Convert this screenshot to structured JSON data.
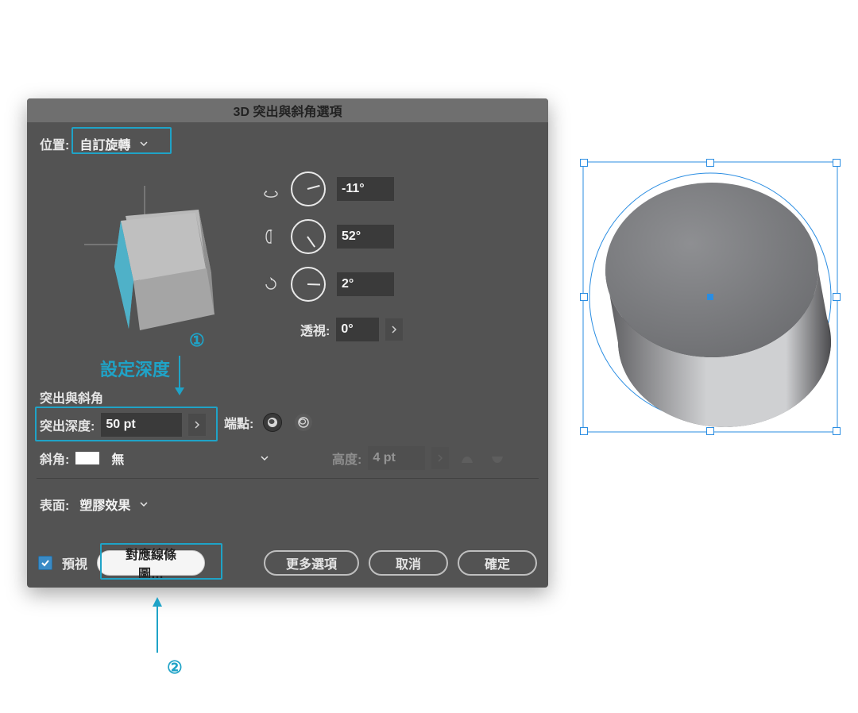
{
  "dialog": {
    "title": "3D 突出與斜角選項",
    "position_label": "位置:",
    "position_value": "自訂旋轉",
    "rotX_value": "-11°",
    "rotY_value": "52°",
    "rotZ_value": "2°",
    "perspective_label": "透視:",
    "perspective_value": "0°",
    "section_extrude_bevel": "突出與斜角",
    "extrude_depth_label": "突出深度:",
    "extrude_depth_value": "50 pt",
    "cap_label": "端點:",
    "bevel_label": "斜角:",
    "bevel_value": "無",
    "bevel_height_label": "高度:",
    "bevel_height_value": "4 pt",
    "surface_label": "表面:",
    "surface_value": "塑膠效果",
    "preview_label": "預視",
    "map_art_label": "對應線條圖…",
    "more_options_label": "更多選項",
    "cancel_label": "取消",
    "ok_label": "確定"
  },
  "annotations": {
    "depth_title": "設定深度",
    "num1": "①",
    "num2": "②"
  },
  "colors": {
    "teal": "#1fa3c7"
  }
}
